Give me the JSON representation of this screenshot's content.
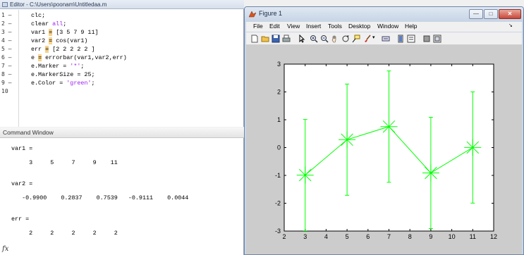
{
  "editor": {
    "title": "Editor - C:\\Users\\poonam\\Untitledaa.m",
    "lines": [
      {
        "num": "1",
        "dash": "–",
        "parts": [
          [
            "",
            "clc;"
          ]
        ]
      },
      {
        "num": "2",
        "dash": "–",
        "parts": [
          [
            "",
            "clear "
          ],
          [
            "kw",
            "all"
          ],
          [
            "",
            ";"
          ]
        ]
      },
      {
        "num": "3",
        "dash": "–",
        "parts": [
          [
            "",
            "var1 "
          ],
          [
            "hl",
            "="
          ],
          [
            "",
            " [3 5 7 9 11]"
          ]
        ]
      },
      {
        "num": "4",
        "dash": "–",
        "parts": [
          [
            "",
            "var2 "
          ],
          [
            "hl",
            "="
          ],
          [
            "",
            " cos(var1)"
          ]
        ]
      },
      {
        "num": "5",
        "dash": "–",
        "parts": [
          [
            "",
            "err "
          ],
          [
            "hl",
            "="
          ],
          [
            "",
            " [2 2 2 2 2 ]"
          ]
        ]
      },
      {
        "num": "6",
        "dash": "–",
        "parts": [
          [
            "",
            "e "
          ],
          [
            "hl",
            "="
          ],
          [
            "",
            " errorbar(var1,var2,err)"
          ]
        ]
      },
      {
        "num": "7",
        "dash": "–",
        "parts": [
          [
            "",
            "e.Marker = "
          ],
          [
            "str",
            "'*'"
          ],
          [
            "",
            ";"
          ]
        ]
      },
      {
        "num": "8",
        "dash": "–",
        "parts": [
          [
            "",
            "e.MarkerSize = 25;"
          ]
        ]
      },
      {
        "num": "9",
        "dash": "–",
        "parts": [
          [
            "",
            "e.Color = "
          ],
          [
            "str",
            "'green'"
          ],
          [
            "",
            ";"
          ]
        ]
      },
      {
        "num": "10",
        "dash": "",
        "parts": []
      }
    ]
  },
  "command_window": {
    "title": "Command Window",
    "lines": [
      "var1 =",
      "",
      "     3     5     7     9    11",
      "",
      "",
      "var2 =",
      "",
      "   -0.9900    0.2837    0.7539   -0.9111    0.0044",
      "",
      "",
      "err =",
      "",
      "     2     2     2     2     2"
    ],
    "prompt_icon": "fx"
  },
  "figure": {
    "title": "Figure 1",
    "menu": [
      "File",
      "Edit",
      "View",
      "Insert",
      "Tools",
      "Desktop",
      "Window",
      "Help"
    ],
    "menu_arrow": "↘",
    "toolbar_icons": [
      "new-figure-icon",
      "open-file-icon",
      "save-icon",
      "print-icon",
      "pointer-icon",
      "zoom-in-icon",
      "zoom-out-icon",
      "pan-icon",
      "rotate-3d-icon",
      "data-cursor-icon",
      "brush-icon",
      "link-plot-icon",
      "colorbar-icon",
      "legend-icon",
      "hide-plot-tools-icon",
      "show-plot-tools-icon"
    ]
  },
  "chart_data": {
    "type": "errorbar",
    "title": "",
    "xlabel": "",
    "ylabel": "",
    "xlim": [
      2,
      12
    ],
    "ylim": [
      -3,
      3
    ],
    "xticks": [
      2,
      3,
      4,
      5,
      6,
      7,
      8,
      9,
      10,
      11,
      12
    ],
    "yticks": [
      -3,
      -2,
      -1,
      0,
      1,
      2,
      3
    ],
    "grid": false,
    "color": "#00ff00",
    "marker": "*",
    "series": [
      {
        "x": [
          3,
          5,
          7,
          9,
          11
        ],
        "y": [
          -0.99,
          0.2837,
          0.7539,
          -0.9111,
          0.0044
        ],
        "err": [
          2,
          2,
          2,
          2,
          2
        ]
      }
    ]
  }
}
